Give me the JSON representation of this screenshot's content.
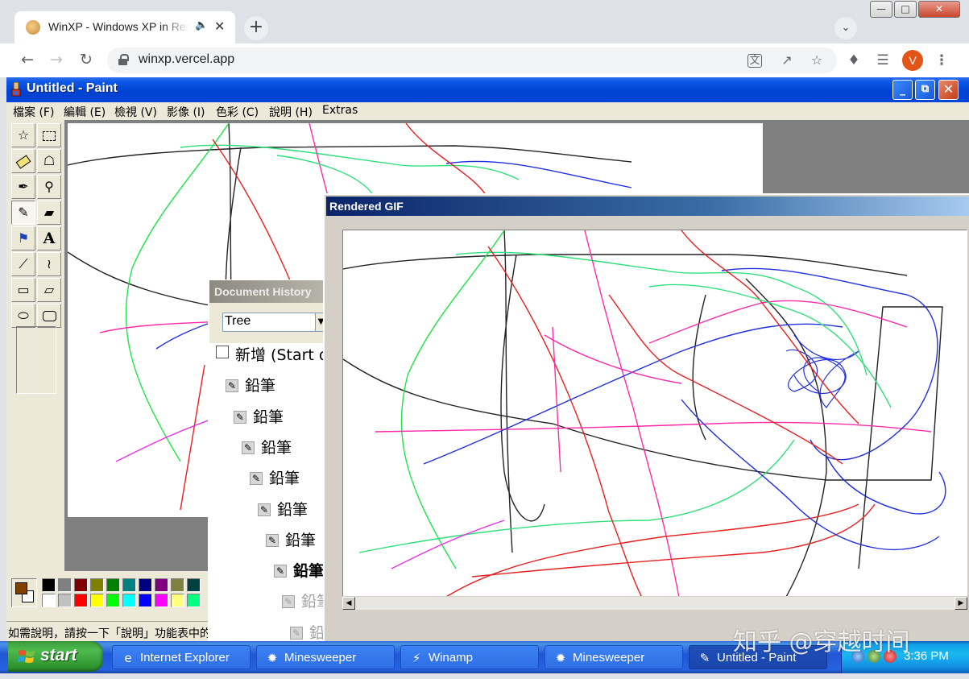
{
  "browser": {
    "tab_title": "WinXP - Windows XP in React",
    "tab_audio_icon": "speaker-icon",
    "new_tab_label": "+",
    "url": "winxp.vercel.app",
    "profile_initial": "V",
    "accent": "#e25516"
  },
  "paint": {
    "title": "Untitled - Paint",
    "menu": [
      "檔案 (F)",
      "編輯 (E)",
      "檢視 (V)",
      "影像 (I)",
      "色彩 (C)",
      "說明 (H)",
      "Extras"
    ],
    "status": "如需說明，請按一下「說明」功能表中的「說明主題」。",
    "tools": [
      "free-select",
      "rect-select",
      "eraser",
      "fill",
      "color-picker",
      "magnifier",
      "pencil",
      "brush",
      "airbrush",
      "text",
      "line",
      "curve",
      "rectangle",
      "polygon",
      "ellipse",
      "rounded-rect"
    ],
    "selected_tool": "pencil",
    "foreground_color": "#804000",
    "background_color": "#ffffff",
    "palette_top": [
      "#000000",
      "#808080",
      "#800000",
      "#808000",
      "#008000",
      "#008080",
      "#000080",
      "#800080",
      "#808040",
      "#004040"
    ],
    "palette_bottom": [
      "#ffffff",
      "#c0c0c0",
      "#ff0000",
      "#ffff00",
      "#00ff00",
      "#00ffff",
      "#0000ff",
      "#ff00ff",
      "#ffff80",
      "#00ff80"
    ]
  },
  "history": {
    "title": "Document History",
    "view_mode": "Tree",
    "items": [
      {
        "label": "新增 (Start o",
        "style": "root"
      },
      {
        "label": "鉛筆",
        "style": "normal"
      },
      {
        "label": "鉛筆",
        "style": "normal"
      },
      {
        "label": "鉛筆",
        "style": "normal"
      },
      {
        "label": "鉛筆",
        "style": "normal"
      },
      {
        "label": "鉛筆",
        "style": "normal"
      },
      {
        "label": "鉛筆",
        "style": "normal"
      },
      {
        "label": "鉛筆",
        "style": "bold"
      },
      {
        "label": "鉛筆",
        "style": "grey"
      },
      {
        "label": "鉛筆",
        "style": "grey"
      }
    ]
  },
  "gif": {
    "title": "Rendered GIF"
  },
  "taskbar": {
    "start_label": "start",
    "items": [
      {
        "label": "Internet Explorer",
        "icon": "ie-icon",
        "active": false
      },
      {
        "label": "Minesweeper",
        "icon": "minesweeper-icon",
        "active": false
      },
      {
        "label": "Winamp",
        "icon": "winamp-icon",
        "active": false
      },
      {
        "label": "Minesweeper",
        "icon": "minesweeper-icon",
        "active": false
      },
      {
        "label": "Untitled - Paint",
        "icon": "paint-icon",
        "active": true
      }
    ],
    "clock": "3:36 PM"
  },
  "watermark": "知乎 @穿越时间"
}
